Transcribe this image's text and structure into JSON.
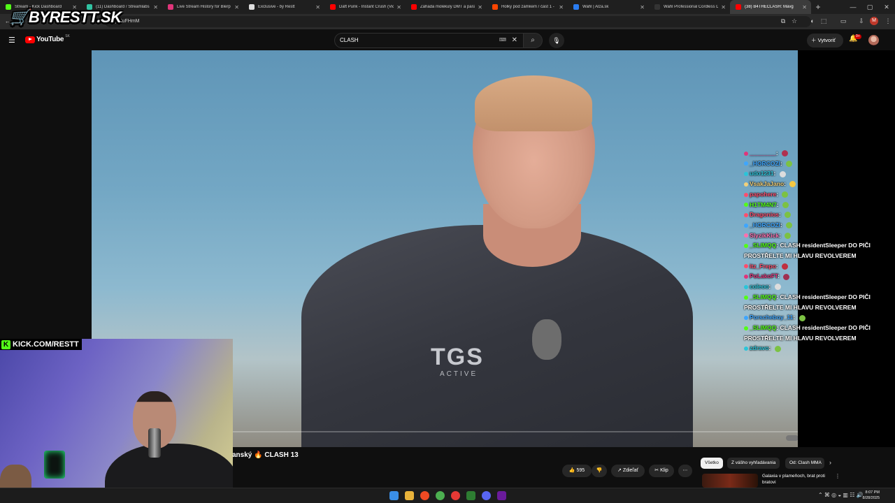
{
  "browser": {
    "tabs": [
      {
        "label": "Stream - Kick Dashboard",
        "color": "#53fc18"
      },
      {
        "label": "(11) Dashboard / Streamlabs",
        "color": "#31c3a2"
      },
      {
        "label": "Live Stream History for Blerp",
        "color": "#e0357a"
      },
      {
        "label": "Exclusive - by Restt",
        "color": "#dddddd"
      },
      {
        "label": "Daft Punk - Instant Crush (Vid",
        "color": "#ff0000"
      },
      {
        "label": "Záhada molekuly DMT a para",
        "color": "#ff0000"
      },
      {
        "label": "Holky pod zámkem / část 1 -",
        "color": "#ff4500"
      },
      {
        "label": "Wahl | Alza.sk",
        "color": "#2a7cf0"
      },
      {
        "label": "Wahl Professional Cordless D",
        "color": "#333333"
      },
      {
        "label": "(38) B4THECLASH: Mavg",
        "color": "#ff0000",
        "active": true
      }
    ],
    "address": "CQytKuFHmM"
  },
  "overlay": {
    "logo_text": "BYRESTT.SK",
    "kick_text": "KICK.COM/RESTT"
  },
  "youtube": {
    "logo": "YouTube",
    "country": "SK",
    "search_value": "CLASH",
    "create_label": "Vytvoriť",
    "notif_count": "9+"
  },
  "video": {
    "title": "anský 🔥 CLASH 13",
    "shirt_text": "TGS",
    "shirt_sub": "ACTIVE",
    "corner_tag": "outer",
    "likes": "595",
    "share_label": "Zdieľať",
    "clip_label": "Klip"
  },
  "chips": [
    "Všetko",
    "Z vášho vyhľadávania",
    "Od: Clash MMA"
  ],
  "recommendation": {
    "title": "Galaxia v plameňoch, brat proti bratovi"
  },
  "chat": [
    {
      "user": "________",
      "color": "#e0357a",
      "msg": "",
      "emo": "#b03050"
    },
    {
      "user": "_HORCOZI",
      "color": "#3ea6ff",
      "msg": "",
      "emo": "#7cc243"
    },
    {
      "user": "udo1231",
      "color": "#2ac5d9",
      "msg": "",
      "emo": "#dddddd"
    },
    {
      "user": "VsakJaJano",
      "color": "#f2d07a",
      "msg": "",
      "emo": "#f5c842"
    },
    {
      "user": "papohere",
      "color": "#ff4d6d",
      "msg": "",
      "emo": "#7cc243"
    },
    {
      "user": "H1TM4N7",
      "color": "#53fc18",
      "msg": "",
      "emo": "#7cc243"
    },
    {
      "user": "Dragonios",
      "color": "#ff4d6d",
      "msg": "",
      "emo": "#7cc243"
    },
    {
      "user": "_HORCOZI",
      "color": "#3ea6ff",
      "msg": "",
      "emo": "#7cc243"
    },
    {
      "user": "SlyzikKick",
      "color": "#ff6fae",
      "msg": "",
      "emo": "#7cc243"
    },
    {
      "user": "_SLIMQQ",
      "color": "#53fc18",
      "msg": "CLASH residentSleeper DO PIČI PROSTŘELTE MI HLAVU REVOLVEREM",
      "emo": ""
    },
    {
      "user": "itz_Frepo",
      "color": "#ff4d6d",
      "msg": "",
      "emo": "#c03040"
    },
    {
      "user": "PoLakoFT",
      "color": "#e0357a",
      "msg": "",
      "emo": "#a03050"
    },
    {
      "user": "coleoo",
      "color": "#2ac5d9",
      "msg": "",
      "emo": "#dddddd"
    },
    {
      "user": "_SLIMQQ",
      "color": "#53fc18",
      "msg": "CLASH residentSleeper DO PIČI PROSTŘELTE MI HLAVU REVOLVEREM",
      "emo": ""
    },
    {
      "user": "Porscheboy_11",
      "color": "#3ea6ff",
      "msg": "",
      "emo": "#7cc243"
    },
    {
      "user": "_SLIMQQ",
      "color": "#53fc18",
      "msg": "CLASH residentSleeper DO PIČI PROSTŘELTE MI HLAVU REVOLVEREM",
      "emo": ""
    },
    {
      "user": "zdravo",
      "color": "#2ac5d9",
      "msg": "",
      "emo": "#7cc243"
    }
  ],
  "clock": {
    "time": "8:07 PM",
    "date": "8/28/2025"
  }
}
